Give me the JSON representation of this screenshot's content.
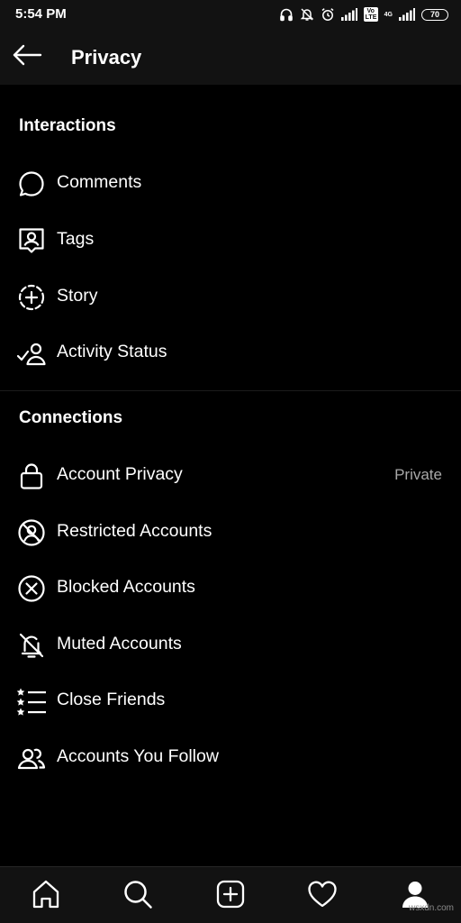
{
  "status_bar": {
    "time": "5:54 PM",
    "volte": "Vo LTE",
    "network": "4G",
    "battery": "70"
  },
  "header": {
    "title": "Privacy"
  },
  "sections": {
    "interactions": {
      "title": "Interactions",
      "items": [
        {
          "label": "Comments",
          "icon": "comment-icon"
        },
        {
          "label": "Tags",
          "icon": "tag-icon"
        },
        {
          "label": "Story",
          "icon": "story-icon"
        },
        {
          "label": "Activity Status",
          "icon": "activity-status-icon"
        }
      ]
    },
    "connections": {
      "title": "Connections",
      "items": [
        {
          "label": "Account Privacy",
          "value": "Private",
          "icon": "lock-icon"
        },
        {
          "label": "Restricted Accounts",
          "icon": "restricted-icon"
        },
        {
          "label": "Blocked Accounts",
          "icon": "blocked-icon"
        },
        {
          "label": "Muted Accounts",
          "icon": "muted-bell-icon"
        },
        {
          "label": "Close Friends",
          "icon": "close-friends-icon"
        },
        {
          "label": "Accounts You Follow",
          "icon": "people-icon"
        }
      ]
    }
  },
  "bottom_nav": [
    "home-icon",
    "search-icon",
    "new-post-icon",
    "heart-icon",
    "profile-icon"
  ],
  "watermark": "wsxdn.com",
  "colors": {
    "background": "#000000",
    "bar": "#121212",
    "text": "#ffffff",
    "secondary_text": "#a8a8a8"
  }
}
